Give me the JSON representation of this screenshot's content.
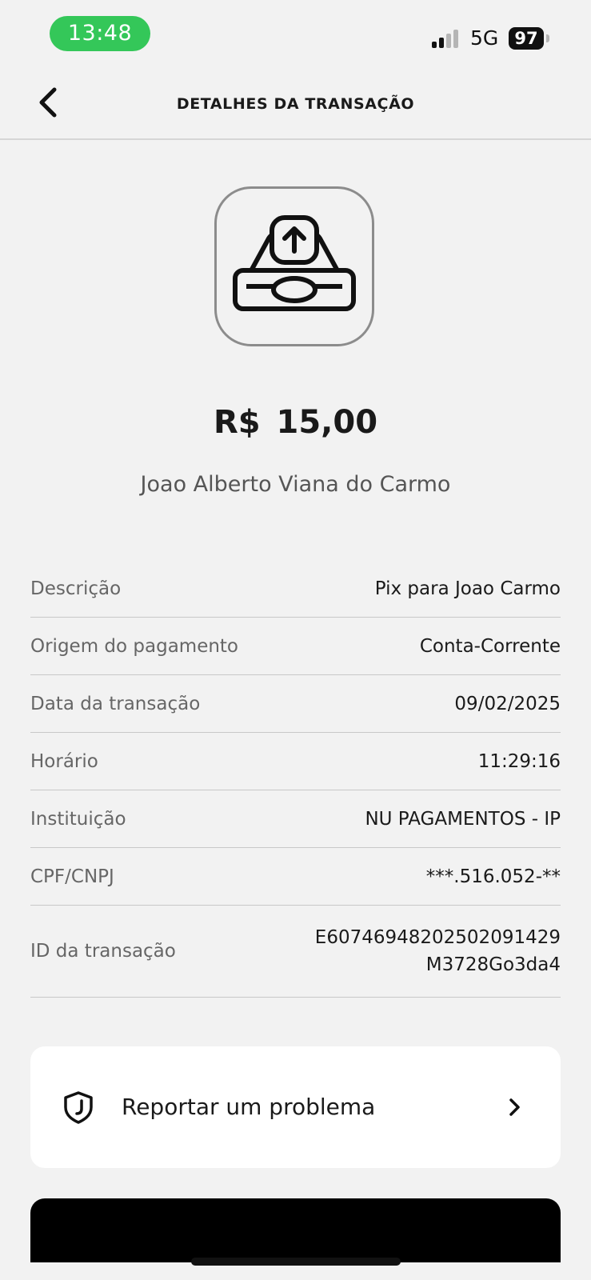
{
  "status_bar": {
    "time": "13:48",
    "network": "5G",
    "battery": "97"
  },
  "header": {
    "title": "DETALHES DA TRANSAÇÃO"
  },
  "transaction": {
    "icon": "pix-upload-tray-icon",
    "amount": "R$ 15,00",
    "recipient": "Joao Alberto Viana do Carmo"
  },
  "details": [
    {
      "label": "Descrição",
      "value": "Pix para Joao Carmo"
    },
    {
      "label": "Origem do pagamento",
      "value": "Conta-Corrente"
    },
    {
      "label": "Data da transação",
      "value": "09/02/2025"
    },
    {
      "label": "Horário",
      "value": "11:29:16"
    },
    {
      "label": "Instituição",
      "value": "NU PAGAMENTOS - IP"
    },
    {
      "label": "CPF/CNPJ",
      "value": "***.516.052-**"
    },
    {
      "label": "ID da transação",
      "value": "E60746948202502091429",
      "value_line2": "M3728Go3da4"
    }
  ],
  "report": {
    "label": "Reportar um problema"
  },
  "colors": {
    "status_pill": "#34c759",
    "background": "#f2f2f2",
    "card": "#ffffff",
    "primary_button": "#000000"
  }
}
